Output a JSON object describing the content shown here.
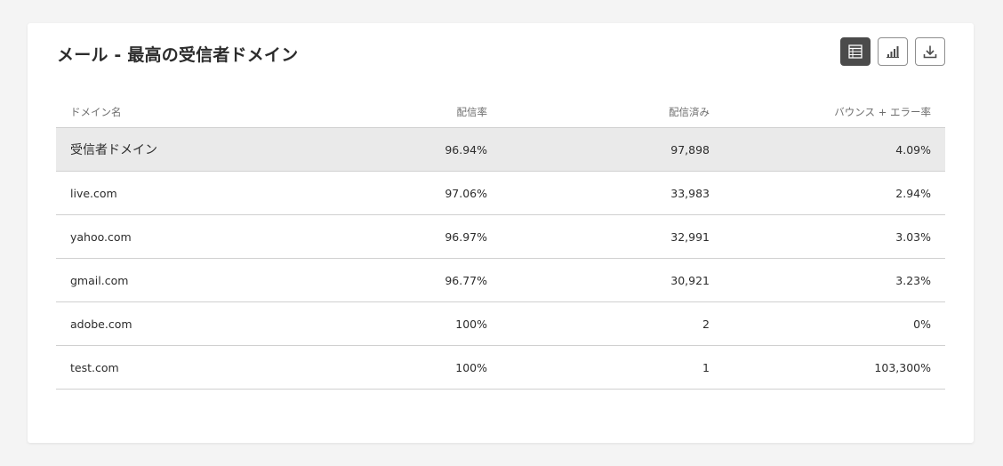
{
  "card": {
    "title": "メール - 最高の受信者ドメイン"
  },
  "toolbar": {
    "buttons": [
      {
        "icon": "table-icon",
        "active": true
      },
      {
        "icon": "bar-chart-icon",
        "active": false
      },
      {
        "icon": "download-icon",
        "active": false
      }
    ]
  },
  "table": {
    "columns": [
      "ドメイン名",
      "配信率",
      "配信済み",
      "バウンス + エラー率"
    ],
    "summary": {
      "name": "受信者ドメイン",
      "rate": "96.94%",
      "delivered": "97,898",
      "bounce": "4.09%"
    },
    "rows": [
      {
        "name": "live.com",
        "rate": "97.06%",
        "delivered": "33,983",
        "bounce": "2.94%"
      },
      {
        "name": "yahoo.com",
        "rate": "96.97%",
        "delivered": "32,991",
        "bounce": "3.03%"
      },
      {
        "name": "gmail.com",
        "rate": "96.77%",
        "delivered": "30,921",
        "bounce": "3.23%"
      },
      {
        "name": "adobe.com",
        "rate": "100%",
        "delivered": "2",
        "bounce": "0%"
      },
      {
        "name": "test.com",
        "rate": "100%",
        "delivered": "1",
        "bounce": "103,300%"
      }
    ]
  }
}
